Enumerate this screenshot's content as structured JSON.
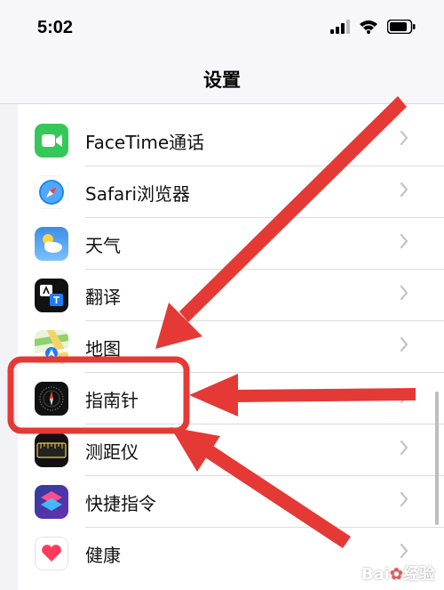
{
  "status_bar": {
    "time": "5:02",
    "icons": [
      "cellular-signal-icon",
      "wifi-icon",
      "battery-icon"
    ]
  },
  "nav": {
    "title": "设置"
  },
  "settings_rows": [
    {
      "label": "FaceTime通话",
      "icon": "facetime-icon"
    },
    {
      "label": "Safari浏览器",
      "icon": "safari-icon"
    },
    {
      "label": "天气",
      "icon": "weather-icon"
    },
    {
      "label": "翻译",
      "icon": "translate-icon"
    },
    {
      "label": "地图",
      "icon": "maps-icon"
    },
    {
      "label": "指南针",
      "icon": "compass-icon",
      "highlighted": true
    },
    {
      "label": "测距仪",
      "icon": "measure-icon"
    },
    {
      "label": "快捷指令",
      "icon": "shortcuts-icon"
    },
    {
      "label": "健康",
      "icon": "health-icon"
    }
  ],
  "annotation": {
    "highlight_color": "#e53935",
    "arrow_color": "#e53935"
  },
  "watermark": {
    "text": "Bai",
    "suffix": "经验"
  }
}
